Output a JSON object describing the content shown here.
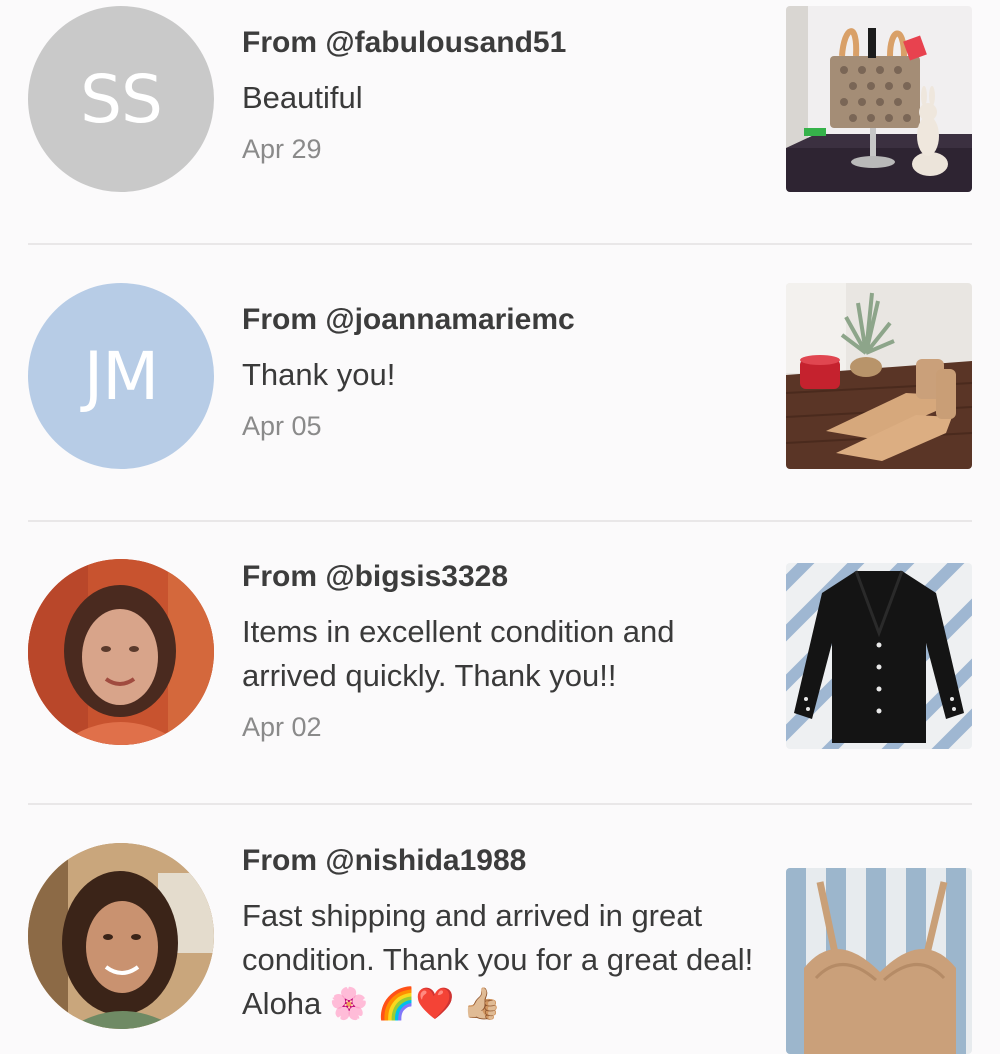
{
  "reviews": [
    {
      "avatar_initials": "SS",
      "avatar_color": "#c9c9c9",
      "from": "From @fabulousand51",
      "message": "Beautiful",
      "date": "Apr 29",
      "thumb_icon": "handbag-photo"
    },
    {
      "avatar_initials": "JM",
      "avatar_color": "#b7cce6",
      "from": "From @joannamariemc",
      "message": "Thank you!",
      "date": "Apr 05",
      "thumb_icon": "sandals-photo"
    },
    {
      "avatar_icon": "user-photo",
      "from": "From @bigsis3328",
      "message": "Items in excellent condition and arrived quickly. Thank you!!",
      "date": "Apr 02",
      "thumb_icon": "cardigan-photo"
    },
    {
      "avatar_icon": "user-photo",
      "from": "From @nishida1988",
      "message": "Fast shipping and arrived in great condition. Thank you for a great deal! Aloha 🌸 🌈❤️ 👍🏼",
      "thumb_icon": "bra-photo"
    }
  ],
  "colors": {
    "background": "#fbfafb",
    "divider": "#e9e7e8",
    "username_text": "#3c3c3c",
    "date_text": "#8a8a8a"
  }
}
